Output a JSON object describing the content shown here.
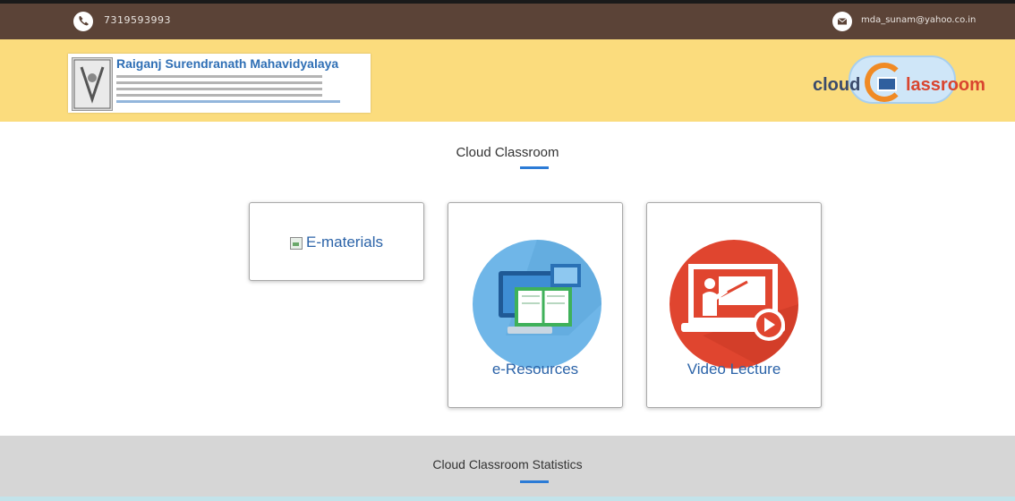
{
  "topbar": {
    "phone": "7319593993",
    "email": "mda_sunam@yahoo.co.in"
  },
  "header": {
    "college_name": "Raiganj Surendranath Mahavidyalaya",
    "logo_word_left": "cloud",
    "logo_word_right": "lassroom"
  },
  "main": {
    "title": "Cloud Classroom",
    "cards": [
      {
        "label": "E-materials",
        "icon": "broken-image-icon"
      },
      {
        "label": "e-Resources",
        "icon": "computer-book-icon"
      },
      {
        "label": "Video Lecture",
        "icon": "video-lecture-icon"
      }
    ]
  },
  "stats": {
    "title": "Cloud Classroom Statistics"
  },
  "colors": {
    "topbar": "#5b4337",
    "header": "#fbdc7d",
    "accent": "#2b7bd6",
    "resources_circle": "#6fb6e8",
    "video_circle": "#e0452f"
  }
}
